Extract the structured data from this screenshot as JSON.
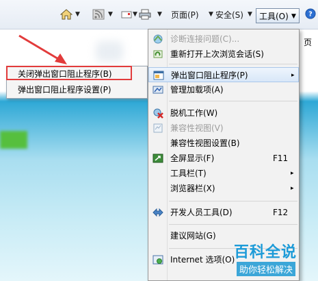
{
  "toolbar": {
    "page_label": "页面(P)",
    "safety_label": "安全(S)",
    "tools_label": "工具(O)",
    "help_label": "?",
    "truncated_text": "页"
  },
  "submenu": {
    "items": [
      {
        "label": "关闭弹出窗口阻止程序(B)"
      },
      {
        "label": "弹出窗口阻止程序设置(P)"
      }
    ]
  },
  "menu": {
    "items": [
      {
        "label": "诊断连接问题(C)...",
        "disabled": true
      },
      {
        "label": "重新打开上次浏览会话(S)"
      },
      {
        "label": "弹出窗口阻止程序(P)",
        "arrow": "▸"
      },
      {
        "label": "管理加载项(A)"
      },
      {
        "label": "脱机工作(W)"
      },
      {
        "label": "兼容性视图(V)",
        "disabled": true
      },
      {
        "label": "兼容性视图设置(B)"
      },
      {
        "label": "全屏显示(F)",
        "accel": "F11"
      },
      {
        "label": "工具栏(T)",
        "arrow": "▸"
      },
      {
        "label": "浏览器栏(X)",
        "arrow": "▸"
      },
      {
        "label": "开发人员工具(D)",
        "accel": "F12"
      },
      {
        "label": "建议网站(G)"
      },
      {
        "label": "Internet 选项(O)"
      }
    ]
  },
  "watermark": {
    "title": "百科全说",
    "subtitle": "助你轻松解决"
  },
  "colors": {
    "highlight_border": "#e23b3b",
    "arrow": "#e23b3b",
    "menu_bg": "#f2f2f2",
    "watermark_blue": "#1d9bd8"
  }
}
